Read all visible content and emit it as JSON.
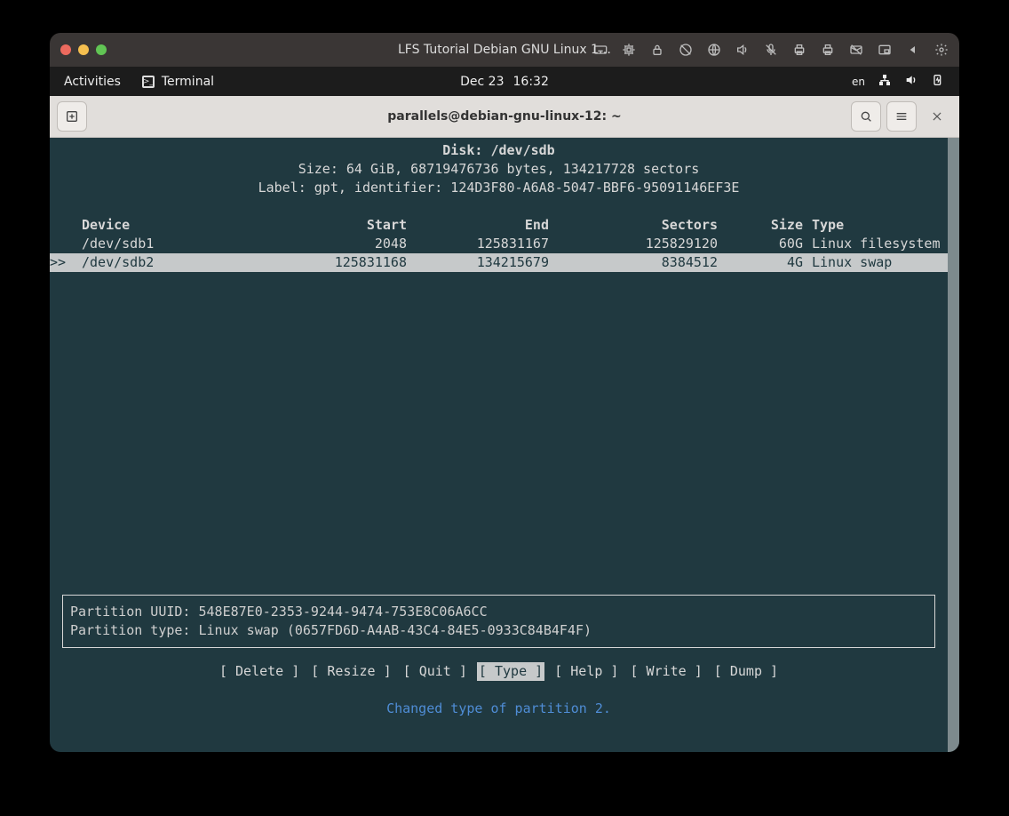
{
  "mac_title": "LFS Tutorial Debian GNU Linux 1…",
  "gnome": {
    "activities": "Activities",
    "terminal": "Terminal",
    "date": "Dec 23",
    "time": "16:32",
    "lang": "en"
  },
  "gn_header": {
    "title": "parallels@debian-gnu-linux-12: ~"
  },
  "cfdisk": {
    "disk_label": "Disk:",
    "disk_path": "/dev/sdb",
    "size_line": "Size: 64 GiB, 68719476736 bytes, 134217728 sectors",
    "label_line": "Label: gpt, identifier: 124D3F80-A6A8-5047-BBF6-95091146EF3E",
    "columns": {
      "device": "Device",
      "start": "Start",
      "end": "End",
      "sectors": "Sectors",
      "size": "Size",
      "type": "Type"
    },
    "partitions": [
      {
        "marker": "",
        "device": "/dev/sdb1",
        "start": "2048",
        "end": "125831167",
        "sectors": "125829120",
        "size": "60G",
        "type": "Linux filesystem",
        "selected": false
      },
      {
        "marker": ">>",
        "device": "/dev/sdb2",
        "start": "125831168",
        "end": "134215679",
        "sectors": "8384512",
        "size": "4G",
        "type": "Linux swap",
        "selected": true
      }
    ],
    "info": {
      "uuid_label": "Partition UUID:",
      "uuid": "548E87E0-2353-9244-9474-753E8C06A6CC",
      "ptype_label": "Partition type:",
      "ptype": "Linux swap (0657FD6D-A4AB-43C4-84E5-0933C84B4F4F)"
    },
    "menu": [
      {
        "text": "[ Delete ]",
        "selected": false
      },
      {
        "text": "[ Resize ]",
        "selected": false
      },
      {
        "text": "[  Quit  ]",
        "selected": false
      },
      {
        "text": "[  Type  ]",
        "selected": true
      },
      {
        "text": "[  Help  ]",
        "selected": false
      },
      {
        "text": "[  Write ]",
        "selected": false
      },
      {
        "text": "[  Dump  ]",
        "selected": false
      }
    ],
    "status": "Changed type of partition 2."
  }
}
